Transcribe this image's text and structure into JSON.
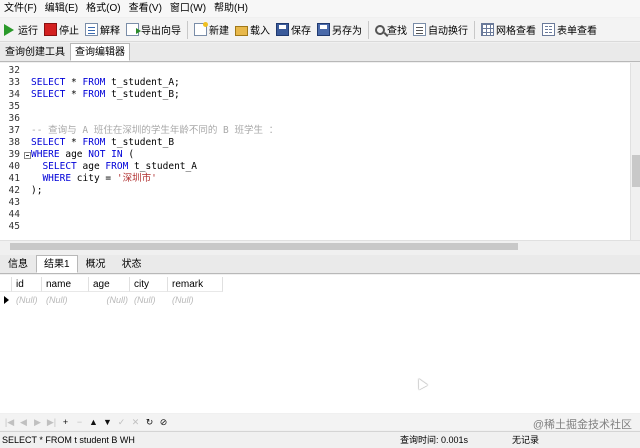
{
  "menu": [
    "文件(F)",
    "编辑(E)",
    "格式(O)",
    "查看(V)",
    "窗口(W)",
    "帮助(H)"
  ],
  "toolbar": {
    "run": "运行",
    "stop": "停止",
    "explain": "解释",
    "export_wizard": "导出向导",
    "new": "新建",
    "load": "载入",
    "save": "保存",
    "save_as": "另存为",
    "find": "查找",
    "word_wrap": "自动换行",
    "grid_view": "网格查看",
    "form_view": "表单查看"
  },
  "doc_tabs": [
    "查询创建工具",
    "查询编辑器"
  ],
  "editor": {
    "lines": [
      {
        "n": "32",
        "html": ""
      },
      {
        "n": "33",
        "html": "SELECT * FROM t_student_A;"
      },
      {
        "n": "34",
        "html": "SELECT * FROM t_student_B;"
      },
      {
        "n": "35",
        "html": ""
      },
      {
        "n": "36",
        "html": ""
      },
      {
        "n": "37",
        "html": "-- 查询与 A 班住在深圳的学生年龄不同的 B 班学生 ："
      },
      {
        "n": "38",
        "html": "SELECT * FROM t_student_B"
      },
      {
        "n": "39",
        "html": "WHERE age NOT IN ("
      },
      {
        "n": "40",
        "html": "  SELECT age FROM t_student_A"
      },
      {
        "n": "41",
        "html": "  WHERE city = '深圳市'"
      },
      {
        "n": "42",
        "html": ");"
      },
      {
        "n": "43",
        "html": ""
      },
      {
        "n": "44",
        "html": ""
      },
      {
        "n": "45",
        "html": ""
      }
    ]
  },
  "result_tabs": [
    "信息",
    "结果1",
    "概况",
    "状态"
  ],
  "result_grid": {
    "columns": [
      "id",
      "name",
      "age",
      "city",
      "remark"
    ],
    "rows": [
      [
        "(Null)",
        "(Null)",
        "(Null)",
        "(Null)",
        "(Null)"
      ]
    ]
  },
  "navbar": [
    "|◀",
    "◀",
    "▶",
    "▶|",
    "+",
    "−",
    "▲",
    "▼",
    "✓",
    "✕",
    "↻",
    "⊘"
  ],
  "status": {
    "sql": "SELECT * FROM t student B WH",
    "query_time": "查询时间: 0.001s",
    "records": "无记录"
  },
  "watermark": "@稀土掘金技术社区"
}
